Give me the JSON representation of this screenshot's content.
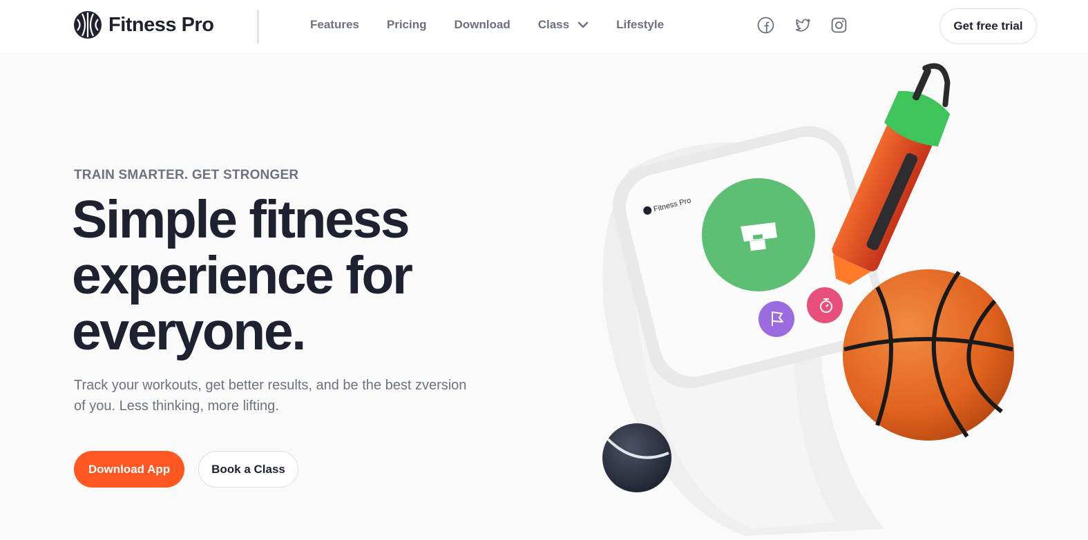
{
  "header": {
    "logo_text": "Fitness Pro",
    "logo_icon": "basketball-logo-icon",
    "nav": [
      {
        "label": "Features"
      },
      {
        "label": "Pricing"
      },
      {
        "label": "Download"
      },
      {
        "label": "Class",
        "icon": "chevron-down-icon"
      },
      {
        "label": "Lifestyle"
      }
    ],
    "socials": [
      "facebook-icon",
      "twitter-icon",
      "instagram-icon"
    ],
    "cta_label": "Get free trial"
  },
  "hero": {
    "eyebrow": "TRAIN SMARTER. GET STRONGER",
    "headline": "Simple fitness experience for everyone.",
    "subtext": "Track your workouts, get better results, and be the best zversion of you. Less thinking, more lifting.",
    "primary_button": "Download App",
    "secondary_button": "Book a Class",
    "watch_brand": "Fitness Pro"
  },
  "colors": {
    "accent": "#ff5722",
    "text": "#1e2130",
    "muted": "#6b7280",
    "watch_green": "#5cbf73",
    "watch_pink": "#e8507b",
    "watch_purple": "#9b6be0"
  }
}
